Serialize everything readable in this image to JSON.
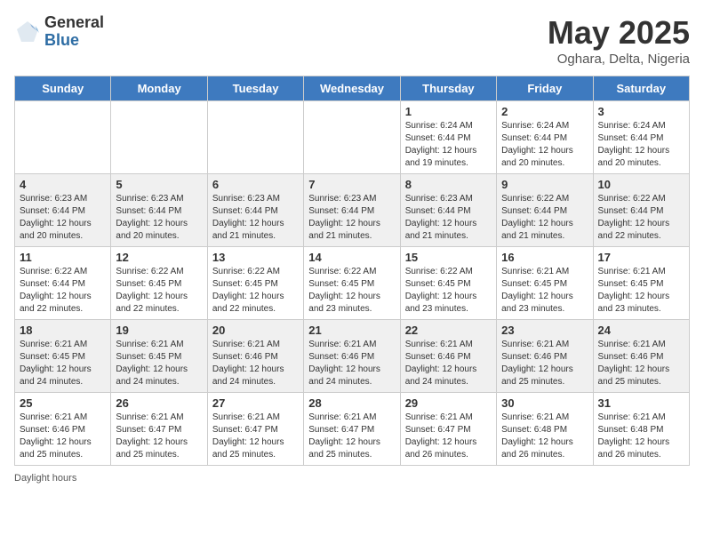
{
  "header": {
    "logo_general": "General",
    "logo_blue": "Blue",
    "title": "May 2025",
    "subtitle": "Oghara, Delta, Nigeria"
  },
  "footer": {
    "label": "Daylight hours"
  },
  "days_of_week": [
    "Sunday",
    "Monday",
    "Tuesday",
    "Wednesday",
    "Thursday",
    "Friday",
    "Saturday"
  ],
  "weeks": [
    [
      {
        "day": "",
        "info": ""
      },
      {
        "day": "",
        "info": ""
      },
      {
        "day": "",
        "info": ""
      },
      {
        "day": "",
        "info": ""
      },
      {
        "day": "1",
        "info": "Sunrise: 6:24 AM\nSunset: 6:44 PM\nDaylight: 12 hours\nand 19 minutes."
      },
      {
        "day": "2",
        "info": "Sunrise: 6:24 AM\nSunset: 6:44 PM\nDaylight: 12 hours\nand 20 minutes."
      },
      {
        "day": "3",
        "info": "Sunrise: 6:24 AM\nSunset: 6:44 PM\nDaylight: 12 hours\nand 20 minutes."
      }
    ],
    [
      {
        "day": "4",
        "info": "Sunrise: 6:23 AM\nSunset: 6:44 PM\nDaylight: 12 hours\nand 20 minutes."
      },
      {
        "day": "5",
        "info": "Sunrise: 6:23 AM\nSunset: 6:44 PM\nDaylight: 12 hours\nand 20 minutes."
      },
      {
        "day": "6",
        "info": "Sunrise: 6:23 AM\nSunset: 6:44 PM\nDaylight: 12 hours\nand 21 minutes."
      },
      {
        "day": "7",
        "info": "Sunrise: 6:23 AM\nSunset: 6:44 PM\nDaylight: 12 hours\nand 21 minutes."
      },
      {
        "day": "8",
        "info": "Sunrise: 6:23 AM\nSunset: 6:44 PM\nDaylight: 12 hours\nand 21 minutes."
      },
      {
        "day": "9",
        "info": "Sunrise: 6:22 AM\nSunset: 6:44 PM\nDaylight: 12 hours\nand 21 minutes."
      },
      {
        "day": "10",
        "info": "Sunrise: 6:22 AM\nSunset: 6:44 PM\nDaylight: 12 hours\nand 22 minutes."
      }
    ],
    [
      {
        "day": "11",
        "info": "Sunrise: 6:22 AM\nSunset: 6:44 PM\nDaylight: 12 hours\nand 22 minutes."
      },
      {
        "day": "12",
        "info": "Sunrise: 6:22 AM\nSunset: 6:45 PM\nDaylight: 12 hours\nand 22 minutes."
      },
      {
        "day": "13",
        "info": "Sunrise: 6:22 AM\nSunset: 6:45 PM\nDaylight: 12 hours\nand 22 minutes."
      },
      {
        "day": "14",
        "info": "Sunrise: 6:22 AM\nSunset: 6:45 PM\nDaylight: 12 hours\nand 23 minutes."
      },
      {
        "day": "15",
        "info": "Sunrise: 6:22 AM\nSunset: 6:45 PM\nDaylight: 12 hours\nand 23 minutes."
      },
      {
        "day": "16",
        "info": "Sunrise: 6:21 AM\nSunset: 6:45 PM\nDaylight: 12 hours\nand 23 minutes."
      },
      {
        "day": "17",
        "info": "Sunrise: 6:21 AM\nSunset: 6:45 PM\nDaylight: 12 hours\nand 23 minutes."
      }
    ],
    [
      {
        "day": "18",
        "info": "Sunrise: 6:21 AM\nSunset: 6:45 PM\nDaylight: 12 hours\nand 24 minutes."
      },
      {
        "day": "19",
        "info": "Sunrise: 6:21 AM\nSunset: 6:45 PM\nDaylight: 12 hours\nand 24 minutes."
      },
      {
        "day": "20",
        "info": "Sunrise: 6:21 AM\nSunset: 6:46 PM\nDaylight: 12 hours\nand 24 minutes."
      },
      {
        "day": "21",
        "info": "Sunrise: 6:21 AM\nSunset: 6:46 PM\nDaylight: 12 hours\nand 24 minutes."
      },
      {
        "day": "22",
        "info": "Sunrise: 6:21 AM\nSunset: 6:46 PM\nDaylight: 12 hours\nand 24 minutes."
      },
      {
        "day": "23",
        "info": "Sunrise: 6:21 AM\nSunset: 6:46 PM\nDaylight: 12 hours\nand 25 minutes."
      },
      {
        "day": "24",
        "info": "Sunrise: 6:21 AM\nSunset: 6:46 PM\nDaylight: 12 hours\nand 25 minutes."
      }
    ],
    [
      {
        "day": "25",
        "info": "Sunrise: 6:21 AM\nSunset: 6:46 PM\nDaylight: 12 hours\nand 25 minutes."
      },
      {
        "day": "26",
        "info": "Sunrise: 6:21 AM\nSunset: 6:47 PM\nDaylight: 12 hours\nand 25 minutes."
      },
      {
        "day": "27",
        "info": "Sunrise: 6:21 AM\nSunset: 6:47 PM\nDaylight: 12 hours\nand 25 minutes."
      },
      {
        "day": "28",
        "info": "Sunrise: 6:21 AM\nSunset: 6:47 PM\nDaylight: 12 hours\nand 25 minutes."
      },
      {
        "day": "29",
        "info": "Sunrise: 6:21 AM\nSunset: 6:47 PM\nDaylight: 12 hours\nand 26 minutes."
      },
      {
        "day": "30",
        "info": "Sunrise: 6:21 AM\nSunset: 6:48 PM\nDaylight: 12 hours\nand 26 minutes."
      },
      {
        "day": "31",
        "info": "Sunrise: 6:21 AM\nSunset: 6:48 PM\nDaylight: 12 hours\nand 26 minutes."
      }
    ]
  ]
}
